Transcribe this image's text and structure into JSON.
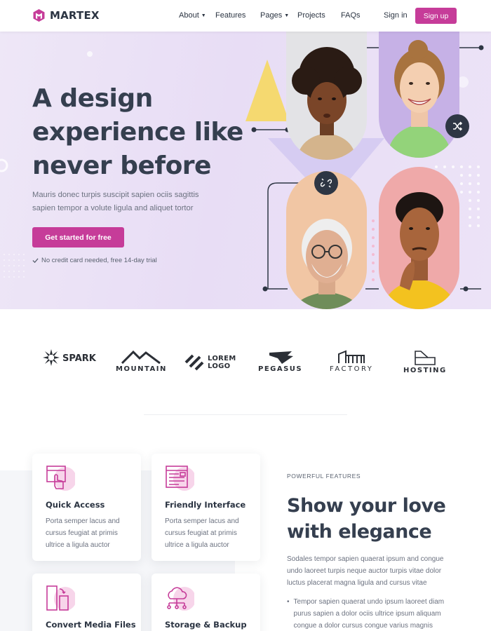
{
  "brand": {
    "name": "MARTEX",
    "accent": "#c63c99"
  },
  "nav": {
    "items": [
      {
        "label": "About",
        "dropdown": true
      },
      {
        "label": "Features",
        "dropdown": false
      },
      {
        "label": "Pages",
        "dropdown": true
      },
      {
        "label": "Projects",
        "dropdown": false
      },
      {
        "label": "FAQs",
        "dropdown": false
      }
    ],
    "sign_in": "Sign in",
    "sign_up": "Sign up"
  },
  "hero": {
    "title": "A design experience like never before",
    "text": "Mauris donec turpis suscipit sapien ociis sagittis sapien tempor a volute ligula and aliquet tortor",
    "cta": "Get started for free",
    "note": "No credit card needed, free 14-day trial"
  },
  "brands": [
    {
      "name": "SPARK",
      "icon": "spark-logo-icon"
    },
    {
      "name": "MOUNTAIN",
      "icon": "mountain-logo-icon"
    },
    {
      "name": "LOREM LOGO",
      "icon": "lorem-logo-icon"
    },
    {
      "name": "PEGASUS",
      "icon": "pegasus-logo-icon"
    },
    {
      "name": "FACTORY",
      "icon": "factory-logo-icon"
    },
    {
      "name": "HOSTING",
      "icon": "hosting-logo-icon"
    }
  ],
  "features": {
    "eyebrow": "POWERFUL FEATURES",
    "title": "Show your love with elegance",
    "text": "Sodales tempor sapien quaerat ipsum and congue undo laoreet turpis neque auctor turpis vitae dolor luctus placerat magna ligula and cursus vitae",
    "bullet": "Tempor sapien quaerat undo ipsum laoreet diam purus sapien a dolor ociis ultrice ipsum aliquam congue a dolor cursus congue varius magnis",
    "cards": [
      {
        "title": "Quick Access",
        "text": "Porta semper lacus and cursus feugiat at primis ultrice a ligula auctor",
        "icon": "touch-screen-icon"
      },
      {
        "title": "Friendly Interface",
        "text": "Porta semper lacus and cursus feugiat at primis ultrice a ligula auctor",
        "icon": "browser-layout-icon"
      },
      {
        "title": "Convert Media Files",
        "text": "",
        "icon": "convert-files-icon"
      },
      {
        "title": "Storage & Backup",
        "text": "",
        "icon": "cloud-network-icon"
      }
    ]
  }
}
